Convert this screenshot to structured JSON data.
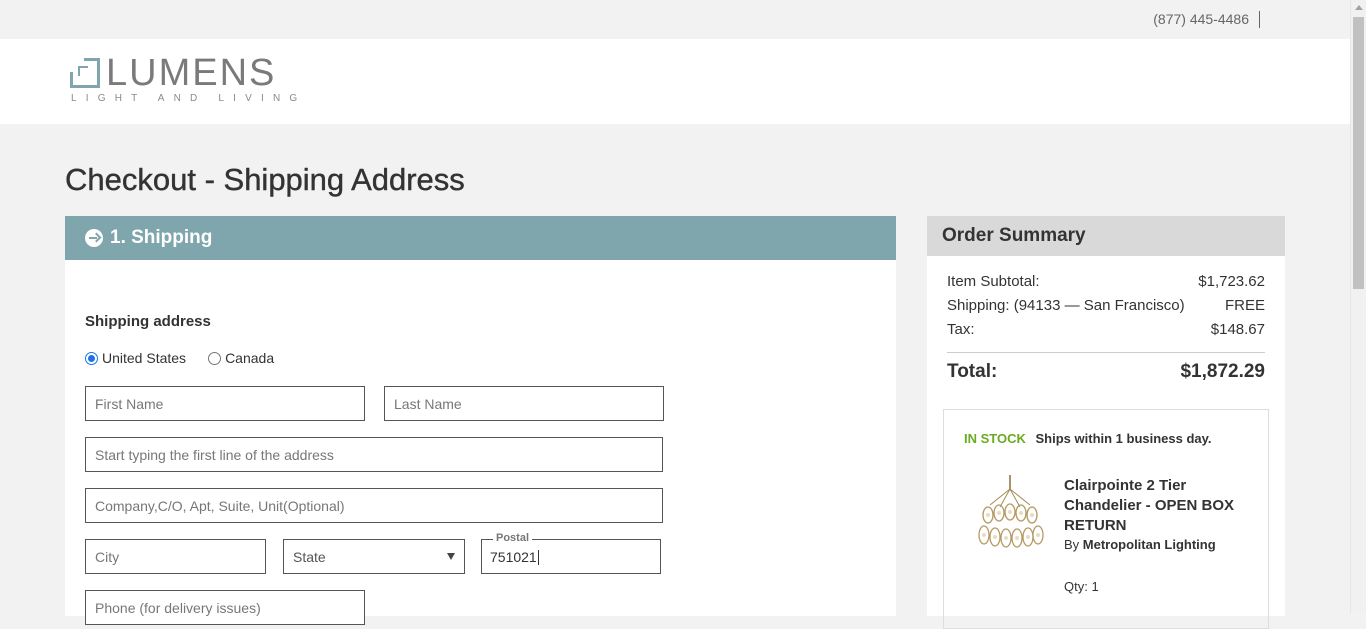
{
  "topbar": {
    "phone": "(877) 445-4486"
  },
  "brand": {
    "name": "LUMENS",
    "tagline": "LIGHT AND LIVING",
    "accent": "#7fa6ad"
  },
  "page": {
    "title": "Checkout - Shipping Address"
  },
  "shipping": {
    "step_title": "1. Shipping",
    "section_label": "Shipping address",
    "countries": [
      {
        "label": "United States",
        "selected": true
      },
      {
        "label": "Canada",
        "selected": false
      }
    ],
    "fields": {
      "first_name_placeholder": "First Name",
      "last_name_placeholder": "Last Name",
      "address_placeholder": "Start typing the first line of the address",
      "company_placeholder": "Company,C/O, Apt, Suite, Unit(Optional)",
      "city_placeholder": "City",
      "state_value": "State",
      "postal_label": "Postal",
      "postal_value": "751021",
      "phone_placeholder": "Phone (for delivery issues)"
    }
  },
  "summary": {
    "title": "Order Summary",
    "subtotal_label": "Item Subtotal:",
    "subtotal_value": "$1,723.62",
    "shipping_label": "Shipping:  (94133 — San Francisco)",
    "shipping_value": "FREE",
    "tax_label": "Tax:",
    "tax_value": "$148.67",
    "total_label": "Total:",
    "total_value": "$1,872.29",
    "item": {
      "stock_badge": "IN STOCK",
      "stock_note": "Ships within 1 business day.",
      "name": "Clairpointe 2 Tier Chandelier - OPEN BOX RETURN",
      "by_prefix": "By",
      "brand": "Metropolitan Lighting",
      "qty": "Qty: 1"
    }
  }
}
